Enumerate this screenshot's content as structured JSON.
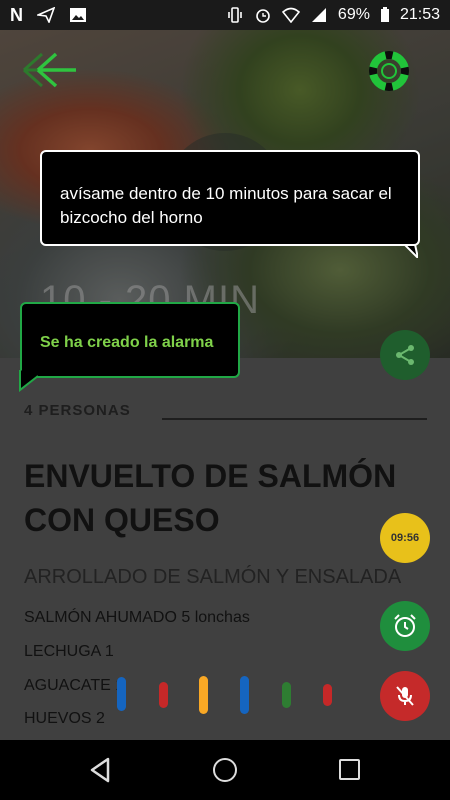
{
  "status_bar": {
    "left_icons": [
      "netflix-icon",
      "send-icon",
      "image-icon"
    ],
    "battery": "69%",
    "time": "21:53",
    "right_icons": [
      "vibrate-icon",
      "alarm-icon",
      "wifi-icon",
      "signal-icon",
      "battery-icon"
    ]
  },
  "recipe": {
    "time": "10 - 20 MIN",
    "persons": "4 PERSONAS",
    "title": "ENVUELTO DE SALMÓN CON QUESO",
    "subtitle": "ARROLLADO DE SALMÓN Y ENSALADA",
    "ingredients": [
      "SALMÓN AHUMADO 5 lonchas",
      "LECHUGA 1",
      "AGUACATE 1",
      "HUEVOS 2"
    ]
  },
  "assistant": {
    "user_query": "avísame dentro de 10 minutos para sacar el bizcocho del horno",
    "response": "Se ha creado la alarma"
  },
  "fabs": {
    "timer_label": "09:56"
  },
  "colors": {
    "accent_green": "#21a846",
    "response_text": "#7fd14a",
    "timer_yellow": "#e8c11a",
    "mic_red": "#c52a2a",
    "voice_bars": [
      "#1565c0",
      "#c62828",
      "#f9a825",
      "#1565c0",
      "#2e7d32",
      "#c62828"
    ]
  }
}
